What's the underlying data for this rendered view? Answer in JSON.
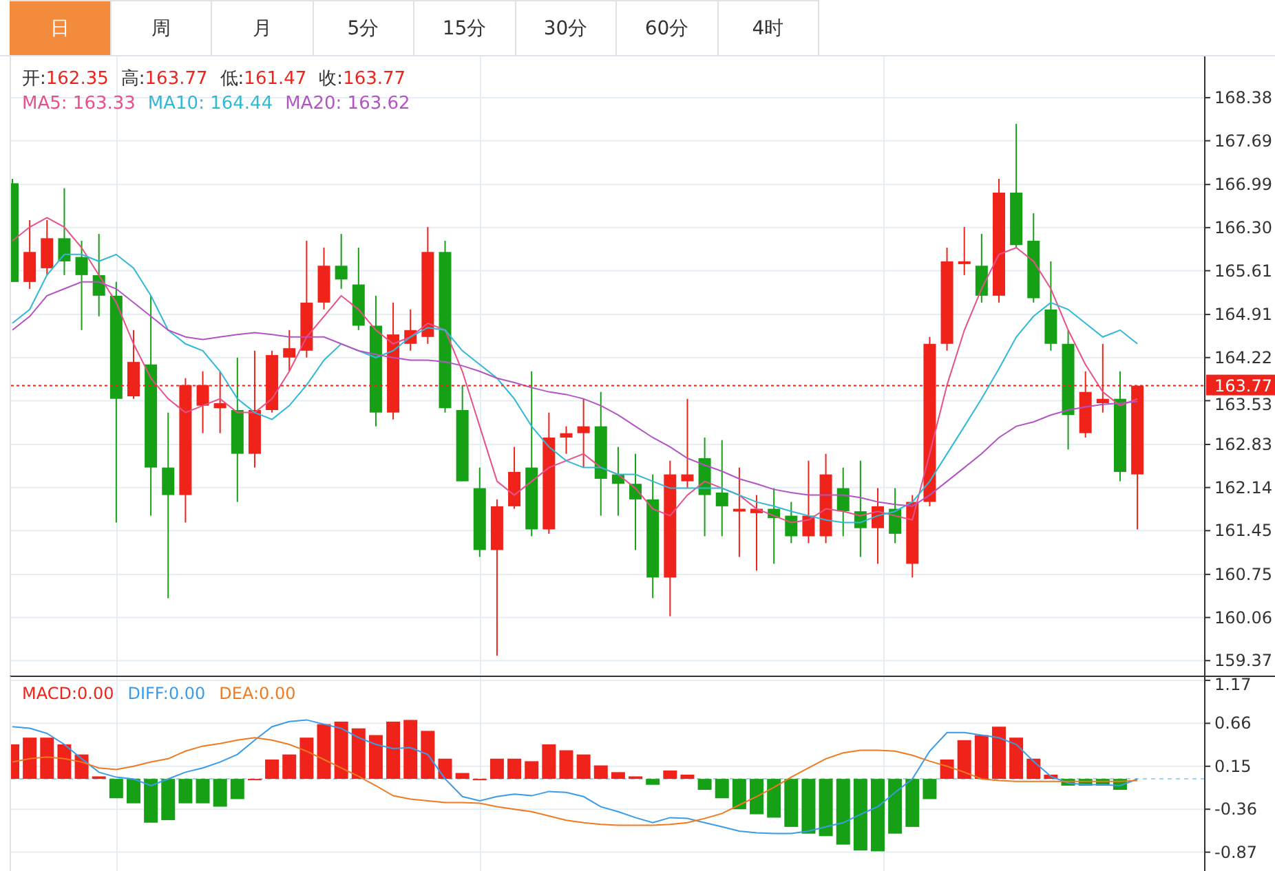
{
  "tabs": [
    {
      "label": "日",
      "selected": true
    },
    {
      "label": "周",
      "selected": false
    },
    {
      "label": "月",
      "selected": false
    },
    {
      "label": "5分",
      "selected": false
    },
    {
      "label": "15分",
      "selected": false
    },
    {
      "label": "30分",
      "selected": false
    },
    {
      "label": "60分",
      "selected": false
    },
    {
      "label": "4时",
      "selected": false
    }
  ],
  "legend": {
    "ohlc": [
      {
        "label": "开:",
        "value": "162.35"
      },
      {
        "label": "高:",
        "value": "163.77"
      },
      {
        "label": "低:",
        "value": "161.47"
      },
      {
        "label": "收:",
        "value": "163.77"
      }
    ],
    "ma": [
      {
        "suffix": ":",
        "value": "163.33"
      },
      {
        "suffix": ":",
        "value": "164.44"
      },
      {
        "suffix": ":",
        "value": "163.62"
      }
    ]
  },
  "main_chart": {
    "chart_data": {
      "type": "candlestick",
      "grid": true,
      "ylim": [
        159.13,
        169.04
      ],
      "yticks": [
        {
          "value": 168.38,
          "label": "168.38"
        },
        {
          "value": 167.69,
          "label": "167.69"
        },
        {
          "value": 166.99,
          "label": "166.99"
        },
        {
          "value": 166.3,
          "label": "166.30"
        },
        {
          "value": 165.61,
          "label": "165.61"
        },
        {
          "value": 164.91,
          "label": "164.91"
        },
        {
          "value": 164.22,
          "label": "164.22"
        },
        {
          "value": 163.53,
          "label": "163.53"
        },
        {
          "value": 162.83,
          "label": "162.83"
        },
        {
          "value": 162.14,
          "label": "162.14"
        },
        {
          "value": 161.45,
          "label": "161.45"
        },
        {
          "value": 160.75,
          "label": "160.75"
        },
        {
          "value": 160.06,
          "label": "160.06"
        },
        {
          "value": 159.37,
          "label": "159.37"
        }
      ],
      "ref_lines": [
        {
          "axis": "y",
          "value": 163.77,
          "label": "163.77",
          "color": "#f0231b"
        }
      ],
      "ohlc": [
        [
          167.01,
          167.08,
          165.43,
          165.43
        ],
        [
          165.43,
          166.42,
          165.32,
          165.91
        ],
        [
          165.65,
          166.42,
          165.54,
          166.13
        ],
        [
          166.13,
          166.93,
          165.54,
          165.76
        ],
        [
          165.83,
          166.09,
          164.66,
          165.54
        ],
        [
          165.54,
          166.2,
          164.88,
          165.21
        ],
        [
          165.21,
          165.43,
          161.58,
          163.56
        ],
        [
          163.6,
          164.66,
          163.56,
          164.15
        ],
        [
          164.11,
          165.21,
          161.69,
          162.46
        ],
        [
          162.46,
          163.34,
          160.37,
          162.02
        ],
        [
          162.02,
          163.89,
          161.58,
          163.78
        ],
        [
          163.45,
          164.0,
          163.01,
          163.78
        ],
        [
          163.41,
          164.0,
          163.01,
          163.49
        ],
        [
          163.38,
          164.22,
          161.91,
          162.68
        ],
        [
          162.68,
          164.33,
          162.46,
          163.38
        ],
        [
          163.38,
          164.33,
          163.34,
          164.26
        ],
        [
          164.22,
          164.66,
          164.0,
          164.37
        ],
        [
          164.33,
          166.09,
          164.22,
          165.1
        ],
        [
          165.1,
          165.98,
          164.99,
          165.69
        ],
        [
          165.69,
          166.2,
          165.32,
          165.47
        ],
        [
          165.39,
          165.98,
          164.66,
          164.73
        ],
        [
          164.73,
          165.21,
          163.12,
          163.34
        ],
        [
          163.34,
          165.1,
          163.23,
          164.59
        ],
        [
          164.44,
          164.99,
          164.33,
          164.66
        ],
        [
          164.55,
          166.31,
          164.44,
          165.91
        ],
        [
          165.91,
          166.09,
          163.34,
          163.41
        ],
        [
          163.38,
          163.78,
          162.24,
          162.24
        ],
        [
          162.13,
          162.46,
          161.03,
          161.14
        ],
        [
          161.14,
          161.95,
          159.45,
          161.84
        ],
        [
          161.84,
          162.79,
          161.8,
          162.39
        ],
        [
          162.46,
          164.0,
          161.36,
          161.47
        ],
        [
          161.47,
          163.34,
          161.4,
          162.94
        ],
        [
          162.94,
          163.12,
          162.68,
          163.01
        ],
        [
          163.01,
          163.56,
          162.46,
          163.12
        ],
        [
          163.12,
          163.67,
          161.69,
          162.28
        ],
        [
          162.35,
          162.79,
          161.69,
          162.2
        ],
        [
          162.2,
          162.68,
          161.14,
          161.95
        ],
        [
          161.95,
          162.35,
          160.37,
          160.7
        ],
        [
          160.7,
          162.57,
          160.08,
          162.35
        ],
        [
          162.24,
          163.56,
          162.13,
          162.35
        ],
        [
          162.61,
          162.94,
          161.36,
          162.02
        ],
        [
          162.06,
          162.9,
          161.36,
          161.84
        ],
        [
          161.76,
          162.46,
          161.03,
          161.8
        ],
        [
          161.73,
          162.02,
          160.81,
          161.8
        ],
        [
          161.8,
          162.13,
          160.92,
          161.65
        ],
        [
          161.69,
          161.91,
          161.25,
          161.36
        ],
        [
          161.36,
          162.57,
          161.25,
          161.69
        ],
        [
          161.36,
          162.68,
          161.25,
          162.35
        ],
        [
          162.13,
          162.46,
          161.36,
          161.76
        ],
        [
          161.76,
          162.57,
          161.03,
          161.49
        ],
        [
          161.49,
          162.13,
          160.92,
          161.84
        ],
        [
          161.8,
          162.13,
          161.25,
          161.4
        ],
        [
          160.92,
          162.02,
          160.7,
          161.91
        ],
        [
          161.91,
          164.55,
          161.84,
          164.44
        ],
        [
          164.44,
          165.98,
          164.33,
          165.76
        ],
        [
          165.72,
          166.31,
          165.54,
          165.76
        ],
        [
          165.69,
          166.2,
          165.1,
          165.21
        ],
        [
          165.21,
          167.08,
          165.1,
          166.86
        ],
        [
          166.86,
          167.96,
          165.98,
          166.02
        ],
        [
          166.09,
          166.53,
          165.1,
          165.17
        ],
        [
          164.99,
          165.76,
          164.33,
          164.44
        ],
        [
          164.44,
          164.66,
          162.75,
          163.3
        ],
        [
          163.01,
          164.0,
          162.94,
          163.67
        ],
        [
          163.49,
          164.44,
          163.34,
          163.56
        ],
        [
          163.56,
          164.0,
          162.24,
          162.39
        ],
        [
          162.35,
          163.77,
          161.47,
          163.77
        ]
      ],
      "series": [
        {
          "name": "MA5",
          "type": "line",
          "color": "#e8508a",
          "values": [
            166.09,
            166.31,
            166.46,
            166.31,
            165.98,
            165.54,
            165.1,
            164.44,
            163.89,
            163.56,
            163.34,
            163.45,
            163.56,
            163.34,
            163.34,
            163.56,
            164.0,
            164.55,
            164.88,
            165.21,
            164.99,
            164.66,
            164.44,
            164.55,
            164.77,
            164.66,
            164.0,
            163.12,
            162.24,
            162.02,
            162.24,
            162.46,
            162.57,
            162.68,
            162.46,
            162.35,
            162.13,
            161.8,
            161.69,
            162.02,
            162.24,
            162.13,
            162.02,
            161.8,
            161.69,
            161.58,
            161.62,
            161.8,
            161.76,
            161.69,
            161.76,
            161.69,
            161.62,
            162.68,
            163.78,
            164.66,
            165.32,
            165.87,
            165.98,
            165.76,
            165.32,
            164.66,
            164.11,
            163.67,
            163.45,
            163.56
          ]
        },
        {
          "name": "MA10",
          "type": "line",
          "color": "#2fb9d6",
          "values": [
            164.77,
            164.99,
            165.54,
            165.87,
            165.87,
            165.76,
            165.87,
            165.65,
            165.21,
            164.66,
            164.44,
            164.33,
            164.0,
            163.56,
            163.34,
            163.23,
            163.45,
            163.78,
            164.18,
            164.44,
            164.33,
            164.22,
            164.33,
            164.55,
            164.7,
            164.66,
            164.33,
            164.11,
            163.89,
            163.56,
            163.12,
            162.79,
            162.57,
            162.46,
            162.46,
            162.35,
            162.35,
            162.24,
            162.13,
            162.13,
            162.13,
            162.13,
            162.02,
            161.91,
            161.84,
            161.76,
            161.69,
            161.62,
            161.58,
            161.58,
            161.69,
            161.76,
            161.91,
            162.24,
            162.68,
            163.12,
            163.56,
            164.04,
            164.55,
            164.88,
            165.1,
            164.99,
            164.77,
            164.55,
            164.66,
            164.44
          ]
        },
        {
          "name": "MA20",
          "type": "line",
          "color": "#b254c4",
          "values": [
            164.66,
            164.88,
            165.21,
            165.32,
            165.43,
            165.43,
            165.32,
            165.1,
            164.88,
            164.66,
            164.55,
            164.51,
            164.55,
            164.59,
            164.62,
            164.59,
            164.55,
            164.55,
            164.55,
            164.44,
            164.33,
            164.27,
            164.22,
            164.18,
            164.18,
            164.15,
            164.09,
            164.0,
            163.89,
            163.82,
            163.74,
            163.67,
            163.63,
            163.56,
            163.45,
            163.3,
            163.12,
            162.94,
            162.79,
            162.61,
            162.5,
            162.4,
            162.28,
            162.2,
            162.11,
            162.06,
            162.02,
            162.02,
            162.02,
            161.98,
            161.91,
            161.87,
            161.84,
            162.02,
            162.24,
            162.46,
            162.68,
            162.94,
            163.12,
            163.19,
            163.3,
            163.38,
            163.43,
            163.47,
            163.49,
            163.52
          ]
        }
      ]
    }
  },
  "macd": {
    "legend": [
      {
        "suffix": ":",
        "value": "0.00"
      },
      {
        "suffix": ":",
        "value": "0.00"
      },
      {
        "suffix": ":",
        "value": "0.00"
      }
    ],
    "chart_data": {
      "type": "bar",
      "grid": true,
      "ylim": [
        -1.11,
        1.21
      ],
      "ref_lines": [
        {
          "axis": "y",
          "value": 0,
          "color": "#9fd3ec"
        }
      ],
      "yticks": [
        {
          "value": 1.17,
          "label": "1.17"
        },
        {
          "value": 0.66,
          "label": "0.66"
        },
        {
          "value": 0.15,
          "label": "0.15"
        },
        {
          "value": -0.36,
          "label": "-0.36"
        },
        {
          "value": -0.87,
          "label": "-0.87"
        }
      ],
      "series": [
        {
          "name": "MACD",
          "color": "#f0231b",
          "colors": [
            "#f0231b",
            "#f0231b",
            "#f0231b",
            "#f0231b",
            "#f0231b",
            "#f0231b",
            "#16a016",
            "#16a016",
            "#16a016",
            "#16a016",
            "#16a016",
            "#16a016",
            "#16a016",
            "#16a016",
            "#f0231b",
            "#f0231b",
            "#f0231b",
            "#f0231b",
            "#f0231b",
            "#f0231b",
            "#f0231b",
            "#f0231b",
            "#f0231b",
            "#f0231b",
            "#f0231b",
            "#f0231b",
            "#f0231b",
            "#f0231b",
            "#f0231b",
            "#f0231b",
            "#f0231b",
            "#f0231b",
            "#f0231b",
            "#f0231b",
            "#f0231b",
            "#f0231b",
            "#f0231b",
            "#16a016",
            "#f0231b",
            "#f0231b",
            "#16a016",
            "#16a016",
            "#16a016",
            "#16a016",
            "#16a016",
            "#16a016",
            "#16a016",
            "#16a016",
            "#16a016",
            "#16a016",
            "#16a016",
            "#16a016",
            "#16a016",
            "#16a016",
            "#f0231b",
            "#f0231b",
            "#f0231b",
            "#f0231b",
            "#f0231b",
            "#f0231b",
            "#f0231b",
            "#16a016",
            "#16a016",
            "#16a016",
            "#16a016"
          ],
          "values": [
            0.41,
            0.49,
            0.49,
            0.41,
            0.29,
            0.03,
            -0.23,
            -0.29,
            -0.52,
            -0.49,
            -0.29,
            -0.29,
            -0.33,
            -0.24,
            0.0,
            0.23,
            0.29,
            0.49,
            0.65,
            0.68,
            0.6,
            0.52,
            0.68,
            0.7,
            0.57,
            0.24,
            0.07,
            0.0,
            0.24,
            0.24,
            0.21,
            0.41,
            0.34,
            0.29,
            0.16,
            0.08,
            0.03,
            -0.07,
            0.1,
            0.05,
            -0.13,
            -0.23,
            -0.36,
            -0.42,
            -0.46,
            -0.57,
            -0.65,
            -0.68,
            -0.78,
            -0.85,
            -0.86,
            -0.65,
            -0.57,
            -0.24,
            0.23,
            0.46,
            0.52,
            0.62,
            0.49,
            0.24,
            0.05,
            -0.08,
            -0.08,
            -0.08,
            -0.13
          ]
        },
        {
          "name": "DIFF",
          "type": "line",
          "color": "#3a9be8",
          "values": [
            0.62,
            0.6,
            0.54,
            0.41,
            0.24,
            0.08,
            0.02,
            0.0,
            -0.08,
            0.0,
            0.08,
            0.13,
            0.2,
            0.29,
            0.46,
            0.62,
            0.68,
            0.7,
            0.65,
            0.6,
            0.49,
            0.41,
            0.36,
            0.37,
            0.29,
            0.0,
            -0.21,
            -0.26,
            -0.21,
            -0.18,
            -0.2,
            -0.15,
            -0.16,
            -0.21,
            -0.33,
            -0.39,
            -0.46,
            -0.52,
            -0.46,
            -0.47,
            -0.52,
            -0.57,
            -0.62,
            -0.64,
            -0.65,
            -0.65,
            -0.62,
            -0.57,
            -0.52,
            -0.42,
            -0.33,
            -0.16,
            0.0,
            0.33,
            0.55,
            0.55,
            0.52,
            0.49,
            0.41,
            0.21,
            0.03,
            -0.05,
            -0.07,
            -0.07,
            -0.08,
            0.0
          ]
        },
        {
          "name": "DEA",
          "type": "line",
          "color": "#f07a20",
          "values": [
            0.2,
            0.24,
            0.26,
            0.24,
            0.2,
            0.13,
            0.11,
            0.15,
            0.2,
            0.24,
            0.33,
            0.39,
            0.42,
            0.46,
            0.49,
            0.46,
            0.41,
            0.33,
            0.23,
            0.13,
            0.03,
            -0.08,
            -0.2,
            -0.24,
            -0.26,
            -0.28,
            -0.28,
            -0.29,
            -0.33,
            -0.36,
            -0.39,
            -0.44,
            -0.49,
            -0.52,
            -0.54,
            -0.55,
            -0.55,
            -0.55,
            -0.54,
            -0.52,
            -0.47,
            -0.41,
            -0.31,
            -0.21,
            -0.1,
            0.02,
            0.13,
            0.24,
            0.31,
            0.34,
            0.34,
            0.33,
            0.28,
            0.21,
            0.15,
            0.08,
            0.0,
            -0.02,
            -0.03,
            -0.03,
            -0.03,
            -0.03,
            -0.03,
            -0.03,
            -0.03,
            -0.02
          ]
        }
      ]
    }
  }
}
